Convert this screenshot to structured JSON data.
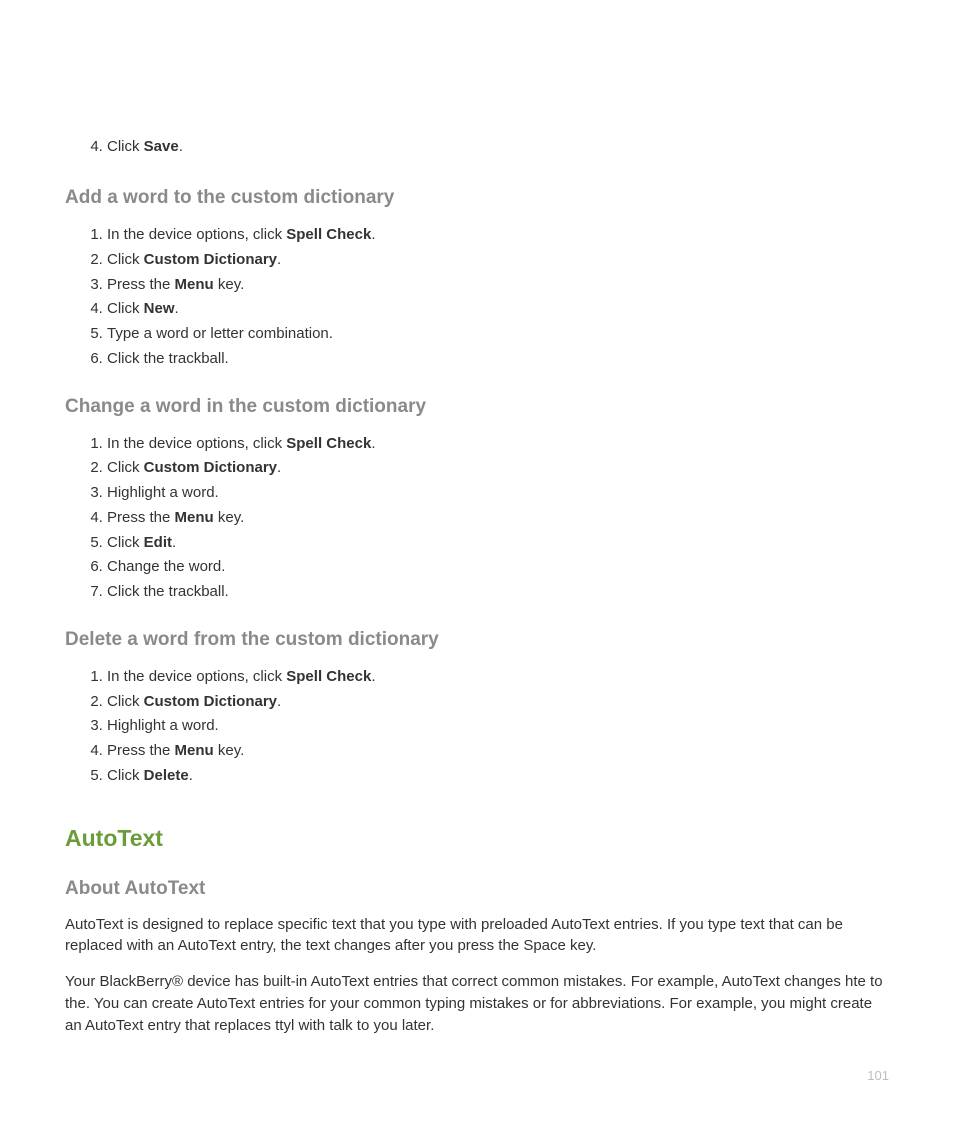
{
  "orphan": {
    "start": 4,
    "item": {
      "pre": "Click ",
      "bold": "Save",
      "post": "."
    }
  },
  "sections": [
    {
      "heading": "Add a word to the custom dictionary",
      "steps": [
        {
          "pre": "In the device options, click ",
          "bold": "Spell Check",
          "post": "."
        },
        {
          "pre": "Click ",
          "bold": "Custom Dictionary",
          "post": "."
        },
        {
          "pre": "Press the ",
          "bold": "Menu",
          "post": " key."
        },
        {
          "pre": "Click ",
          "bold": "New",
          "post": "."
        },
        {
          "pre": "Type a word or letter combination.",
          "bold": "",
          "post": ""
        },
        {
          "pre": "Click the trackball.",
          "bold": "",
          "post": ""
        }
      ]
    },
    {
      "heading": "Change a word in the custom dictionary",
      "steps": [
        {
          "pre": "In the device options, click ",
          "bold": "Spell Check",
          "post": "."
        },
        {
          "pre": "Click ",
          "bold": "Custom Dictionary",
          "post": "."
        },
        {
          "pre": "Highlight a word.",
          "bold": "",
          "post": ""
        },
        {
          "pre": "Press the ",
          "bold": "Menu",
          "post": " key."
        },
        {
          "pre": "Click ",
          "bold": "Edit",
          "post": "."
        },
        {
          "pre": "Change the word.",
          "bold": "",
          "post": ""
        },
        {
          "pre": "Click the trackball.",
          "bold": "",
          "post": ""
        }
      ]
    },
    {
      "heading": "Delete a word from the custom dictionary",
      "steps": [
        {
          "pre": "In the device options, click ",
          "bold": "Spell Check",
          "post": "."
        },
        {
          "pre": "Click ",
          "bold": "Custom Dictionary",
          "post": "."
        },
        {
          "pre": "Highlight a word.",
          "bold": "",
          "post": ""
        },
        {
          "pre": "Press the ",
          "bold": "Menu",
          "post": " key."
        },
        {
          "pre": "Click ",
          "bold": "Delete",
          "post": "."
        }
      ]
    }
  ],
  "autotext": {
    "title": "AutoText",
    "subheading": "About AutoText",
    "p1": "AutoText is designed to replace specific text that you type with preloaded AutoText entries. If you type text that can be replaced with an AutoText entry, the text changes after you press the Space key.",
    "p2": "Your BlackBerry® device has built-in AutoText entries that correct common mistakes. For example, AutoText changes hte to the. You can create AutoText entries for your common typing mistakes or for abbreviations. For example, you might create an AutoText entry that replaces ttyl with talk to you later."
  },
  "pageNumber": "101"
}
